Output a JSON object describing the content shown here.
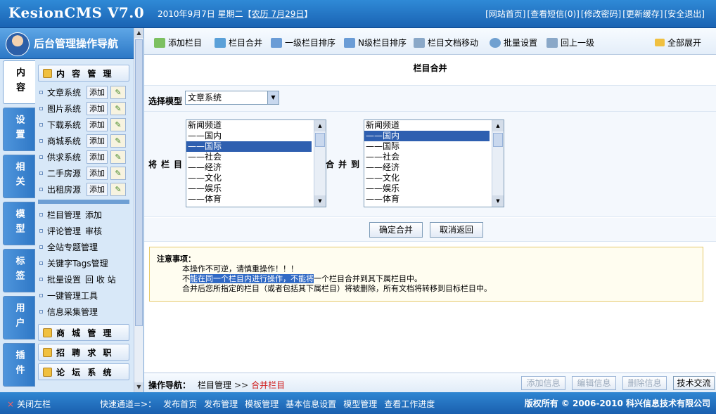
{
  "header": {
    "logo": "KesionCMS V7.0",
    "date": "2010年9月7日 星期二【",
    "lunar": "农历 7月29日",
    "date_end": "】",
    "links": [
      "[网站首页]",
      "[查看短信(0)]",
      "[修改密码]",
      "[更新缓存]",
      "[安全退出]"
    ]
  },
  "sidebar": {
    "title": "后台管理操作导航",
    "tabs": [
      "内容",
      "设置",
      "相关",
      "模型",
      "标签",
      "用户",
      "插件"
    ],
    "group1": "内 容 管 理",
    "systems": [
      {
        "label": "文章系统",
        "add": "添加"
      },
      {
        "label": "图片系统",
        "add": "添加"
      },
      {
        "label": "下载系统",
        "add": "添加"
      },
      {
        "label": "商城系统",
        "add": "添加"
      },
      {
        "label": "供求系统",
        "add": "添加"
      },
      {
        "label": "二手房源",
        "add": "添加"
      },
      {
        "label": "出租房源",
        "add": "添加"
      }
    ],
    "items2": [
      {
        "label": "栏目管理",
        "sub": "添加"
      },
      {
        "label": "评论管理",
        "sub": "审核"
      },
      {
        "label": "全站专题管理",
        "sub": ""
      },
      {
        "label": "关键字Tags管理",
        "sub": ""
      },
      {
        "label": "批量设置",
        "sub": "回 收 站"
      },
      {
        "label": "一键管理工具",
        "sub": ""
      },
      {
        "label": "信息采集管理",
        "sub": ""
      }
    ],
    "groups": [
      "商 城 管 理",
      "招 聘 求 职",
      "论 坛 系 统"
    ]
  },
  "toolbar": {
    "buttons": [
      "添加栏目",
      "栏目合并",
      "一级栏目排序",
      "N级栏目排序",
      "栏目文档移动",
      "批量设置",
      "回上一级"
    ],
    "expand": "全部展开"
  },
  "page": {
    "title": "栏目合并",
    "model_label": "选择模型",
    "model_value": "文章系统",
    "source_label": "将栏目",
    "target_label": "合并到",
    "source_options": [
      "新闻频道",
      "——国内",
      "——国际",
      "——社会",
      "——经济",
      "——文化",
      "——娱乐",
      "——体育"
    ],
    "source_selected": 2,
    "target_options": [
      "新闻频道",
      "——国内",
      "——国际",
      "——社会",
      "——经济",
      "——文化",
      "——娱乐",
      "——体育"
    ],
    "target_selected": 1,
    "confirm": "确定合并",
    "cancel": "取消返回"
  },
  "notice": {
    "title": "注意事项：",
    "line1": "本操作不可逆，请慎重操作！！！",
    "line2_a": "不",
    "line2_hl": "能在同一个栏目内进行操作，不能将",
    "line2_b": "一个栏目合并到其下属栏目中。",
    "line3": "合并后您所指定的栏目（或者包括其下属栏目）将被删除，所有文档将转移到目标栏目中。"
  },
  "navbar": {
    "label": "操作导航：",
    "crumb": "栏目管理",
    "arrow": ">>",
    "current": "合并栏目",
    "buttons": [
      "添加信息",
      "编辑信息",
      "删除信息",
      "技术交流"
    ]
  },
  "footer": {
    "close": "关闭左栏",
    "quick_label": "快速通道=>：",
    "quick_links": [
      "发布首页",
      "发布管理",
      "模板管理",
      "基本信息设置",
      "模型管理",
      "查看工作进度"
    ],
    "copyright": "版权所有 © 2006-2010 科兴信息技术有限公司"
  }
}
